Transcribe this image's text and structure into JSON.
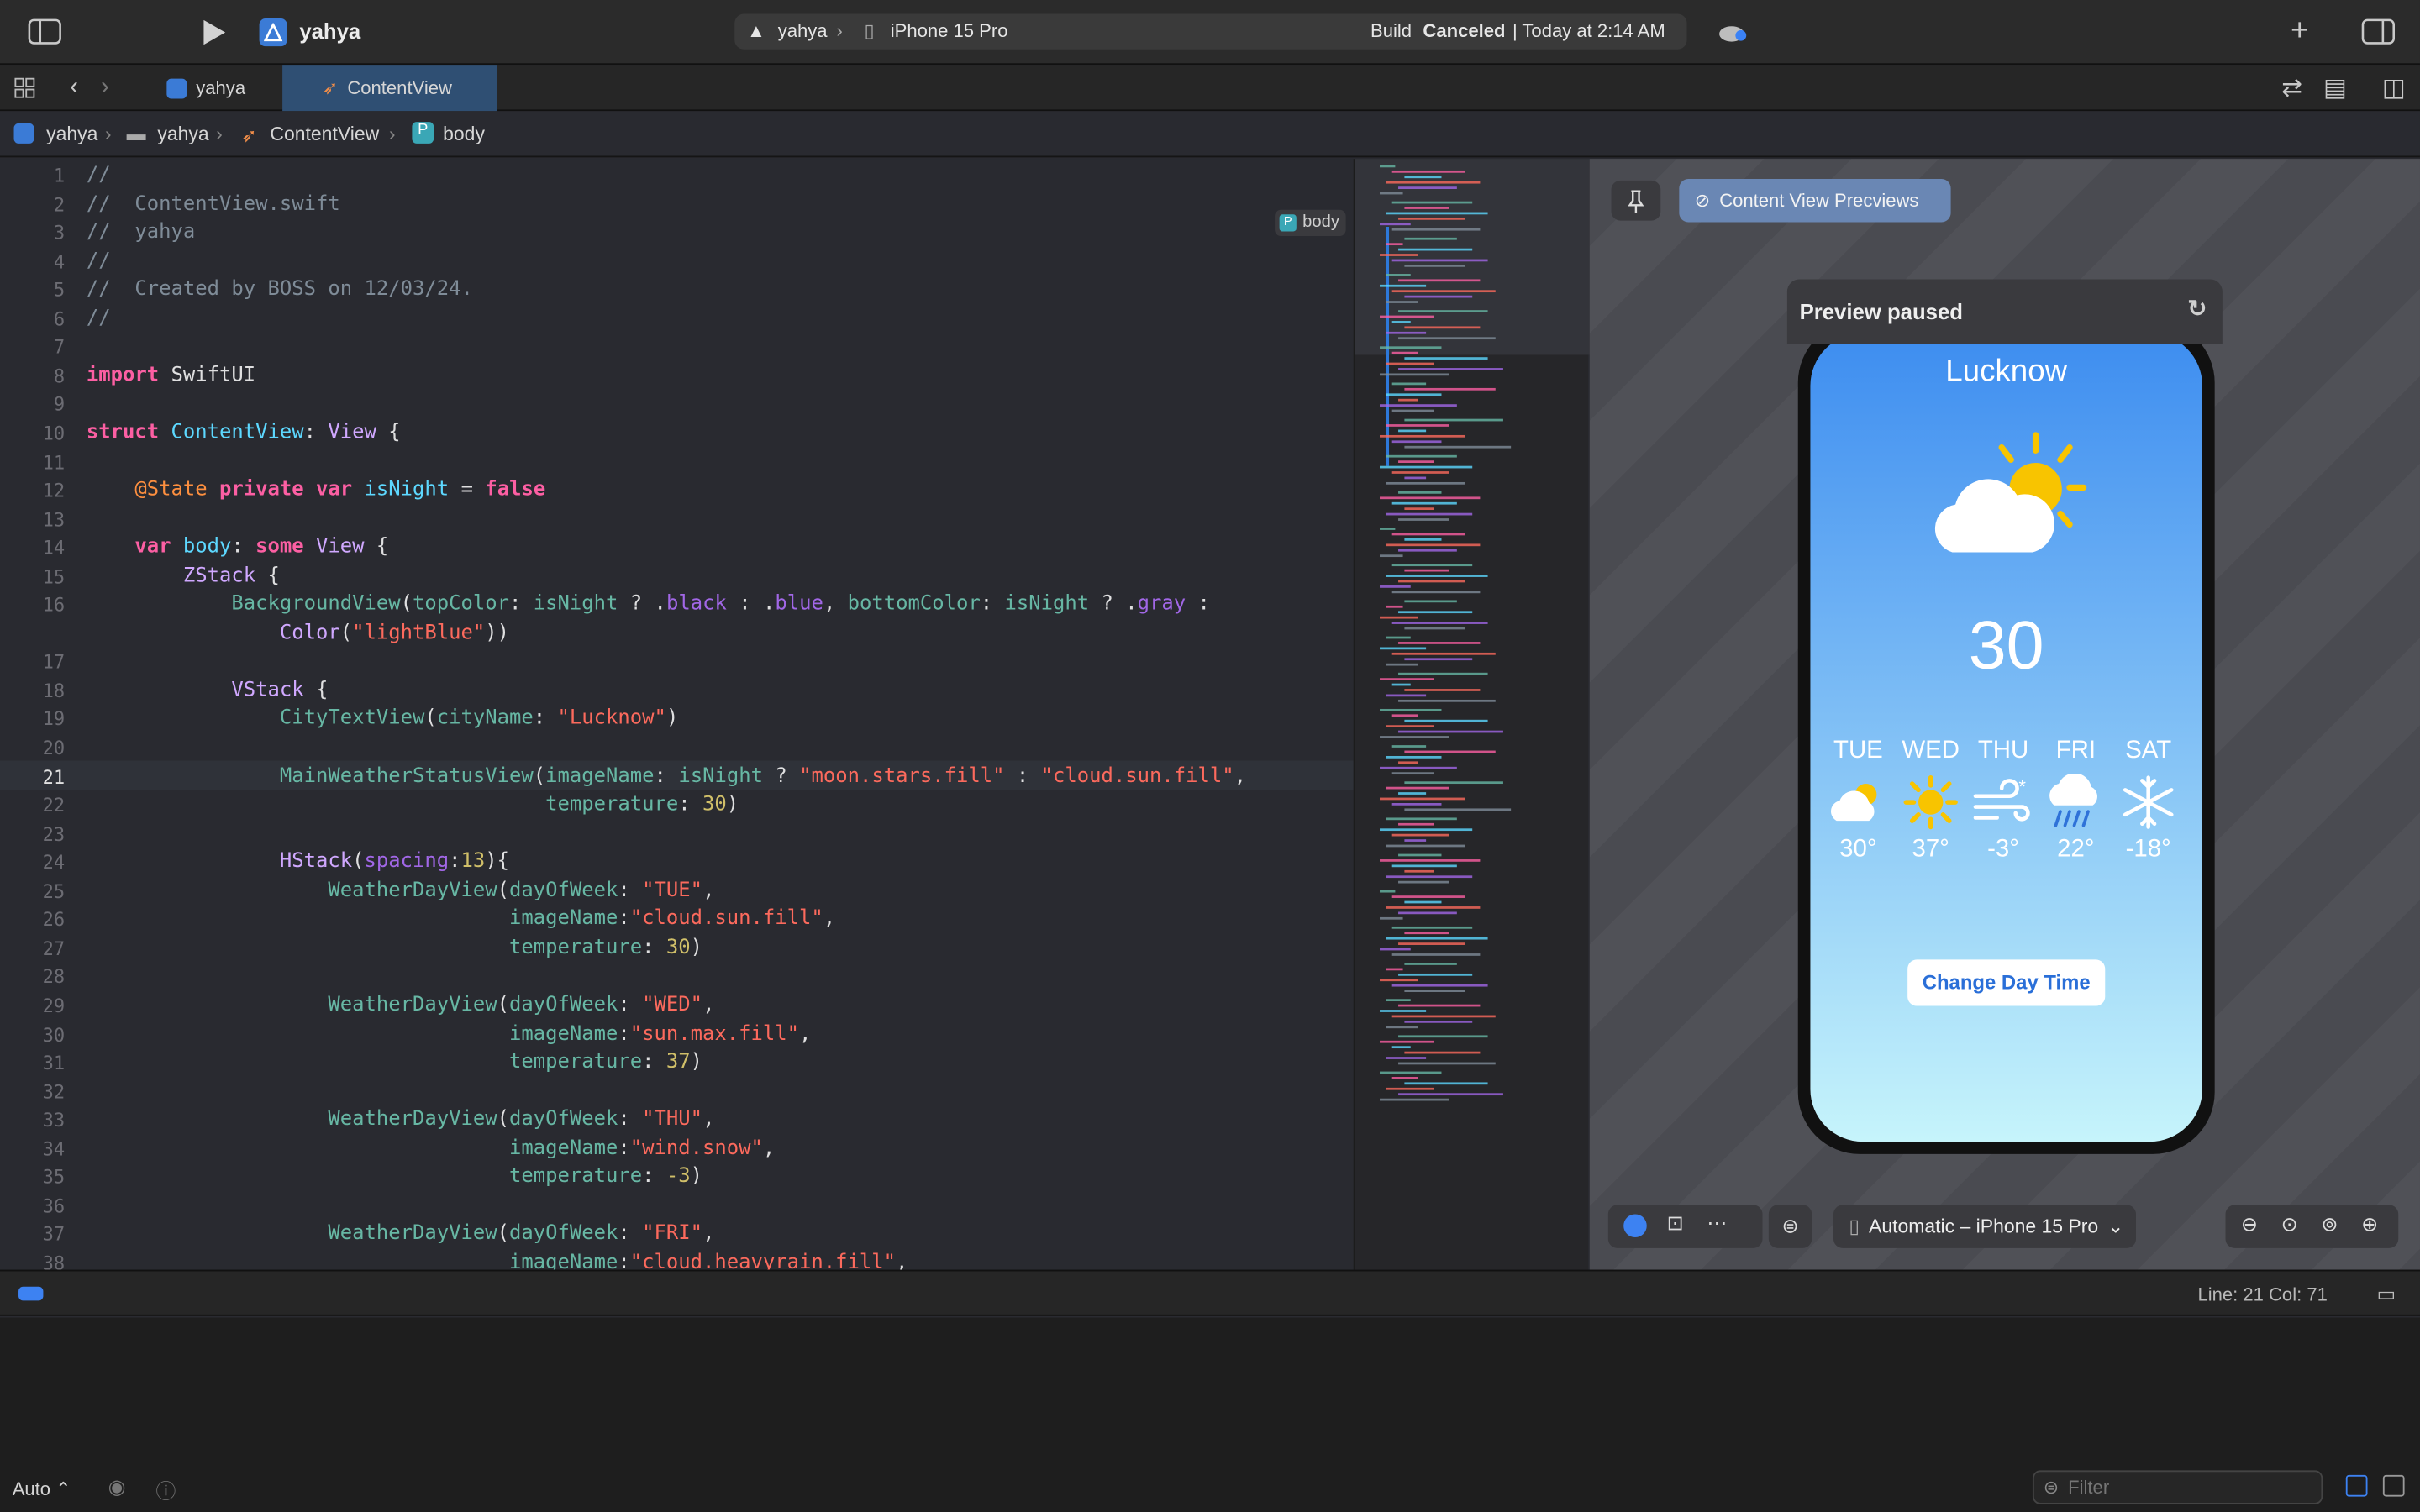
{
  "toolbar": {
    "project": "yahya",
    "scheme_target": "yahya",
    "device": "iPhone 15 Pro",
    "build_status_prefix": "Build",
    "build_status": "Canceled",
    "build_time": "| Today at 2:14 AM"
  },
  "tabs": [
    {
      "label": "yahya"
    },
    {
      "label": "ContentView"
    }
  ],
  "breadcrumb": [
    "yahya",
    "yahya",
    "ContentView",
    "body"
  ],
  "editor": {
    "badge": "body",
    "current_line": 21
  },
  "preview": {
    "pin_label": "Content View Precviews",
    "paused": "Preview paused",
    "city": "Lucknow",
    "temperature": "30",
    "button": "Change Day Time",
    "days": [
      {
        "d": "TUE",
        "t": "30°"
      },
      {
        "d": "WED",
        "t": "37°"
      },
      {
        "d": "THU",
        "t": "-3°"
      },
      {
        "d": "FRI",
        "t": "22°"
      },
      {
        "d": "SAT",
        "t": "-18°"
      }
    ],
    "device_selector": "Automatic – iPhone 15 Pro"
  },
  "status": {
    "position": "Line: 21  Col: 71"
  },
  "console": {
    "mode": "Auto ⌃",
    "filter_placeholder": "Filter"
  },
  "colors": {
    "accent": "#2f4f73",
    "sky_top": "#3d8df0",
    "sky_bottom": "#c6f4fb"
  }
}
